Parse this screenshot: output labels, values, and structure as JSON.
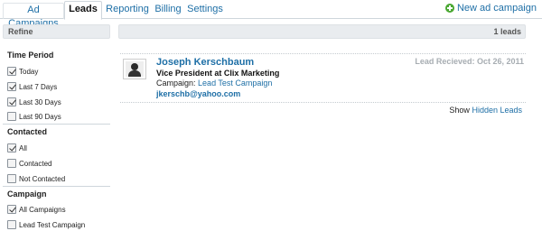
{
  "tabs": [
    {
      "label": "Ad Campaigns"
    },
    {
      "label": "Leads"
    },
    {
      "label": "Reporting"
    },
    {
      "label": "Billing"
    },
    {
      "label": "Settings"
    }
  ],
  "new_ad_label": "New ad campaign",
  "sidebar": {
    "header": "Refine",
    "sections": [
      {
        "title": "Time Period",
        "options": [
          {
            "label": "Today",
            "checked": true
          },
          {
            "label": "Last 7 Days",
            "checked": true
          },
          {
            "label": "Last 30 Days",
            "checked": true
          },
          {
            "label": "Last 90 Days",
            "checked": false
          }
        ]
      },
      {
        "title": "Contacted",
        "options": [
          {
            "label": "All",
            "checked": true
          },
          {
            "label": "Contacted",
            "checked": false
          },
          {
            "label": "Not Contacted",
            "checked": false
          }
        ]
      },
      {
        "title": "Campaign",
        "options": [
          {
            "label": "All Campaigns",
            "checked": true
          },
          {
            "label": "Lead Test Campaign",
            "checked": false
          }
        ]
      }
    ]
  },
  "main": {
    "count": "1 leads",
    "lead": {
      "name": "Joseph Kerschbaum",
      "title": "Vice President at Clix Marketing",
      "campaign_prefix": "Campaign:",
      "campaign": "Lead Test Campaign",
      "email": "jkerschb@yahoo.com",
      "received": "Lead Recieved: Oct 26, 2011"
    },
    "show_prefix": "Show",
    "show_link": "Hidden Leads"
  }
}
